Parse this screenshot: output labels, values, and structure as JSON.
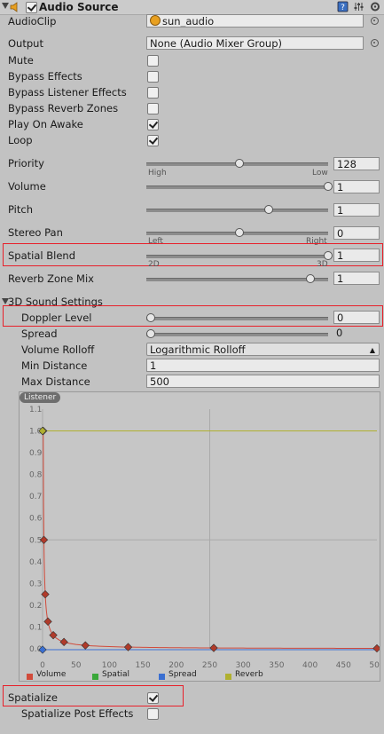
{
  "component": {
    "title": "Audio Source",
    "enabled": true
  },
  "fields": {
    "audio_clip": {
      "label": "AudioClip",
      "value": "sun_audio"
    },
    "output": {
      "label": "Output",
      "value": "None (Audio Mixer Group)"
    },
    "mute": {
      "label": "Mute",
      "checked": false
    },
    "bypass_effects": {
      "label": "Bypass Effects",
      "checked": false
    },
    "bypass_listener": {
      "label": "Bypass Listener Effects",
      "checked": false
    },
    "bypass_reverb": {
      "label": "Bypass Reverb Zones",
      "checked": false
    },
    "play_on_awake": {
      "label": "Play On Awake",
      "checked": true
    },
    "loop": {
      "label": "Loop",
      "checked": true
    },
    "priority": {
      "label": "Priority",
      "value": "128",
      "level": 0.5,
      "min_label": "High",
      "max_label": "Low"
    },
    "volume": {
      "label": "Volume",
      "value": "1",
      "level": 1.0
    },
    "pitch": {
      "label": "Pitch",
      "value": "1",
      "level": 0.667
    },
    "stereo_pan": {
      "label": "Stereo Pan",
      "value": "0",
      "level": 0.5,
      "min_label": "Left",
      "max_label": "Right"
    },
    "spatial_blend": {
      "label": "Spatial Blend",
      "value": "1",
      "level": 1.0,
      "min_label": "2D",
      "max_label": "3D"
    },
    "reverb_zone_mix": {
      "label": "Reverb Zone Mix",
      "value": "1",
      "level": 0.9
    }
  },
  "sound3d": {
    "section_title": "3D Sound Settings",
    "doppler_level": {
      "label": "Doppler Level",
      "value": "0",
      "level": 0.0
    },
    "spread": {
      "label": "Spread",
      "value": "0",
      "level": 0.0
    },
    "volume_rolloff": {
      "label": "Volume Rolloff",
      "value": "Logarithmic Rolloff"
    },
    "min_distance": {
      "label": "Min Distance",
      "value": "1"
    },
    "max_distance": {
      "label": "Max Distance",
      "value": "500"
    }
  },
  "graph": {
    "listener_label": "Listener",
    "y_ticks": [
      "1.1",
      "1.0",
      "0.9",
      "0.8",
      "0.7",
      "0.6",
      "0.5",
      "0.4",
      "0.3",
      "0.2",
      "0.1",
      "0.0"
    ],
    "x_ticks": [
      "0",
      "50",
      "100",
      "150",
      "200",
      "250",
      "300",
      "350",
      "400",
      "450",
      "500"
    ],
    "legend": [
      {
        "name": "Volume",
        "color": "#d14b3b"
      },
      {
        "name": "Spatial",
        "color": "#3aa83a"
      },
      {
        "name": "Spread",
        "color": "#3a6fd1"
      },
      {
        "name": "Reverb",
        "color": "#b0b030"
      }
    ]
  },
  "spatialize": {
    "label": "Spatialize",
    "checked": true
  },
  "spatialize_post": {
    "label": "Spatialize Post Effects",
    "checked": false
  }
}
